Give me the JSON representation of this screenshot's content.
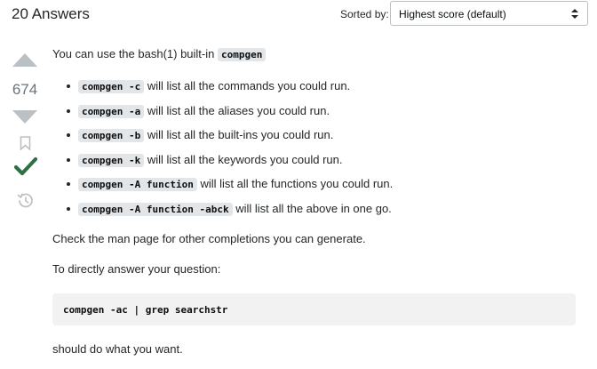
{
  "header": {
    "answers_count": "20 Answers",
    "sorted_label": "Sorted by:",
    "sort_value": "Highest score (default)"
  },
  "votes": {
    "score": "674",
    "accepted": true,
    "icons": [
      "vote-up-icon",
      "vote-down-icon",
      "bookmark-icon",
      "accepted-check-icon",
      "history-icon"
    ]
  },
  "post": {
    "intro_text": "You can use the bash(1) built-in ",
    "intro_code": "compgen",
    "bullets": [
      {
        "code": "compgen -c",
        "text": " will list all the commands you could run."
      },
      {
        "code": "compgen -a",
        "text": " will list all the aliases you could run."
      },
      {
        "code": "compgen -b",
        "text": " will list all the built-ins you could run."
      },
      {
        "code": "compgen -k",
        "text": " will list all the keywords you could run."
      },
      {
        "code": "compgen -A function",
        "text": " will list all the functions you could run."
      },
      {
        "code": "compgen -A function -abck",
        "text": " will list all the above in one go."
      }
    ],
    "man_text": "Check the man page for other completions you can generate.",
    "answer_text": "To directly answer your question:",
    "code_block": "compgen -ac | grep searchstr",
    "closing_text": "should do what you want."
  },
  "colors": {
    "accepted_green": "#2f6f44",
    "vote_arrow": "#bbc0c4",
    "code_bg": "#e3e6e8"
  }
}
